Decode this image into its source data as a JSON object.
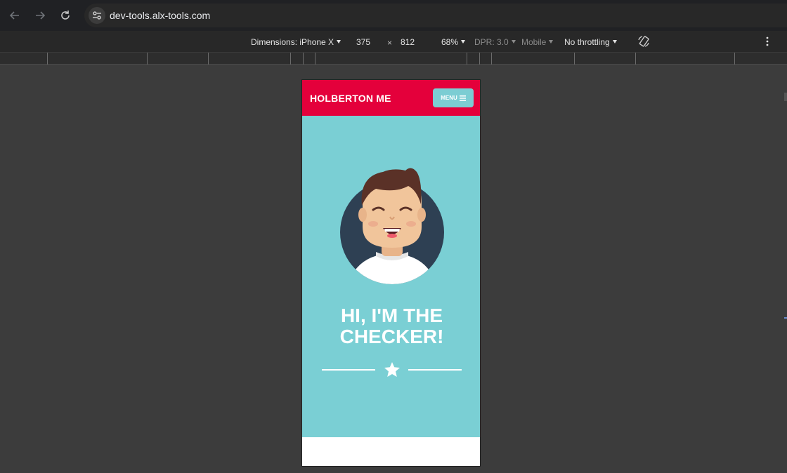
{
  "browser": {
    "back_icon": "arrow-left-icon",
    "forward_icon": "arrow-right-icon",
    "reload_icon": "reload-icon",
    "site_info_icon": "tune-icon",
    "url": "dev-tools.alx-tools.com"
  },
  "devtools": {
    "dimensions_label": "Dimensions: iPhone X",
    "width": "375",
    "times": "×",
    "height": "812",
    "zoom": "68%",
    "dpr": "DPR: 3.0",
    "mode": "Mobile",
    "throttling": "No throttling",
    "rotate_icon": "rotate-icon",
    "more_icon": "more-vert-icon"
  },
  "site": {
    "brand": "HOLBERTON ME",
    "menu_label": "MENU",
    "menu_icon": "hamburger-icon",
    "hero_title_line1": "HI, I'M THE",
    "hero_title_line2": "CHECKER!",
    "colors": {
      "header": "#e4003b",
      "hero": "#7acfd4",
      "menu_button": "#7ccdd3",
      "avatar_bg": "#2e4053"
    }
  }
}
